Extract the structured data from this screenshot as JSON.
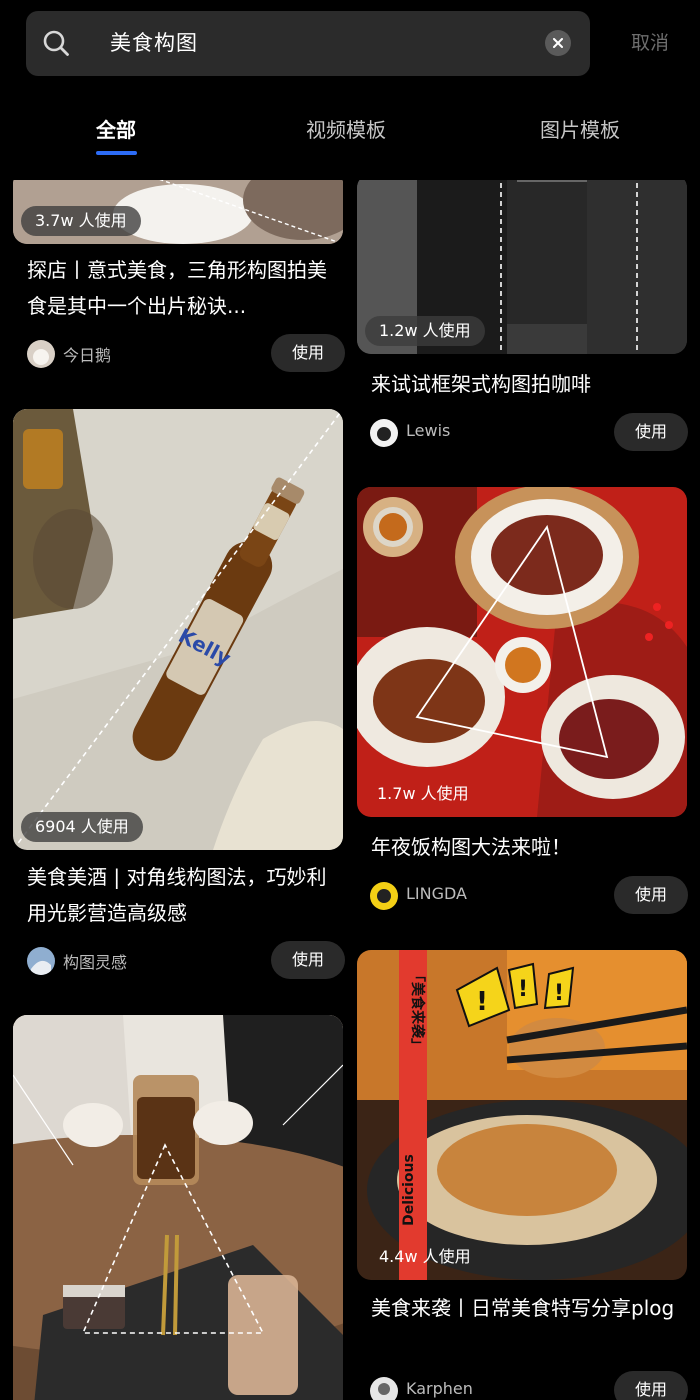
{
  "search": {
    "query": "美食构图",
    "cancel_label": "取消"
  },
  "tabs": [
    {
      "label": "全部",
      "active": true
    },
    {
      "label": "视频模板",
      "active": false
    },
    {
      "label": "图片模板",
      "active": false
    }
  ],
  "colors": {
    "accent": "#2c6cf6",
    "background": "#000000",
    "card_button": "#2a2a2a"
  },
  "cards": [
    {
      "usage": "3.7w 人使用",
      "title": "探店丨意式美食，三角形构图拍美食是其中一个出片秘诀...",
      "author": "今日鹅",
      "button": "使用"
    },
    {
      "usage": "1.2w 人使用",
      "title": "来试试框架式构图拍咖啡",
      "author": "Lewis",
      "button": "使用"
    },
    {
      "usage": "6904 人使用",
      "title": "美食美酒 | 对角线构图法，巧妙利用光影营造高级感",
      "author": "构图灵感",
      "button": "使用"
    },
    {
      "usage": "1.7w 人使用",
      "title": "年夜饭构图大法来啦！",
      "author": "LINGDA",
      "button": "使用"
    },
    {
      "usage": "",
      "title": "",
      "author": "",
      "button": ""
    },
    {
      "usage": "4.4w 人使用",
      "title": "美食来袭丨日常美食特写分享plog",
      "author": "Karphen",
      "button": "使用"
    }
  ],
  "images": {
    "beer_bottle_label": "Kelly",
    "banner_text": "「美食来袭」",
    "banner_text_2": "Delicious",
    "alert_mark": "!"
  }
}
